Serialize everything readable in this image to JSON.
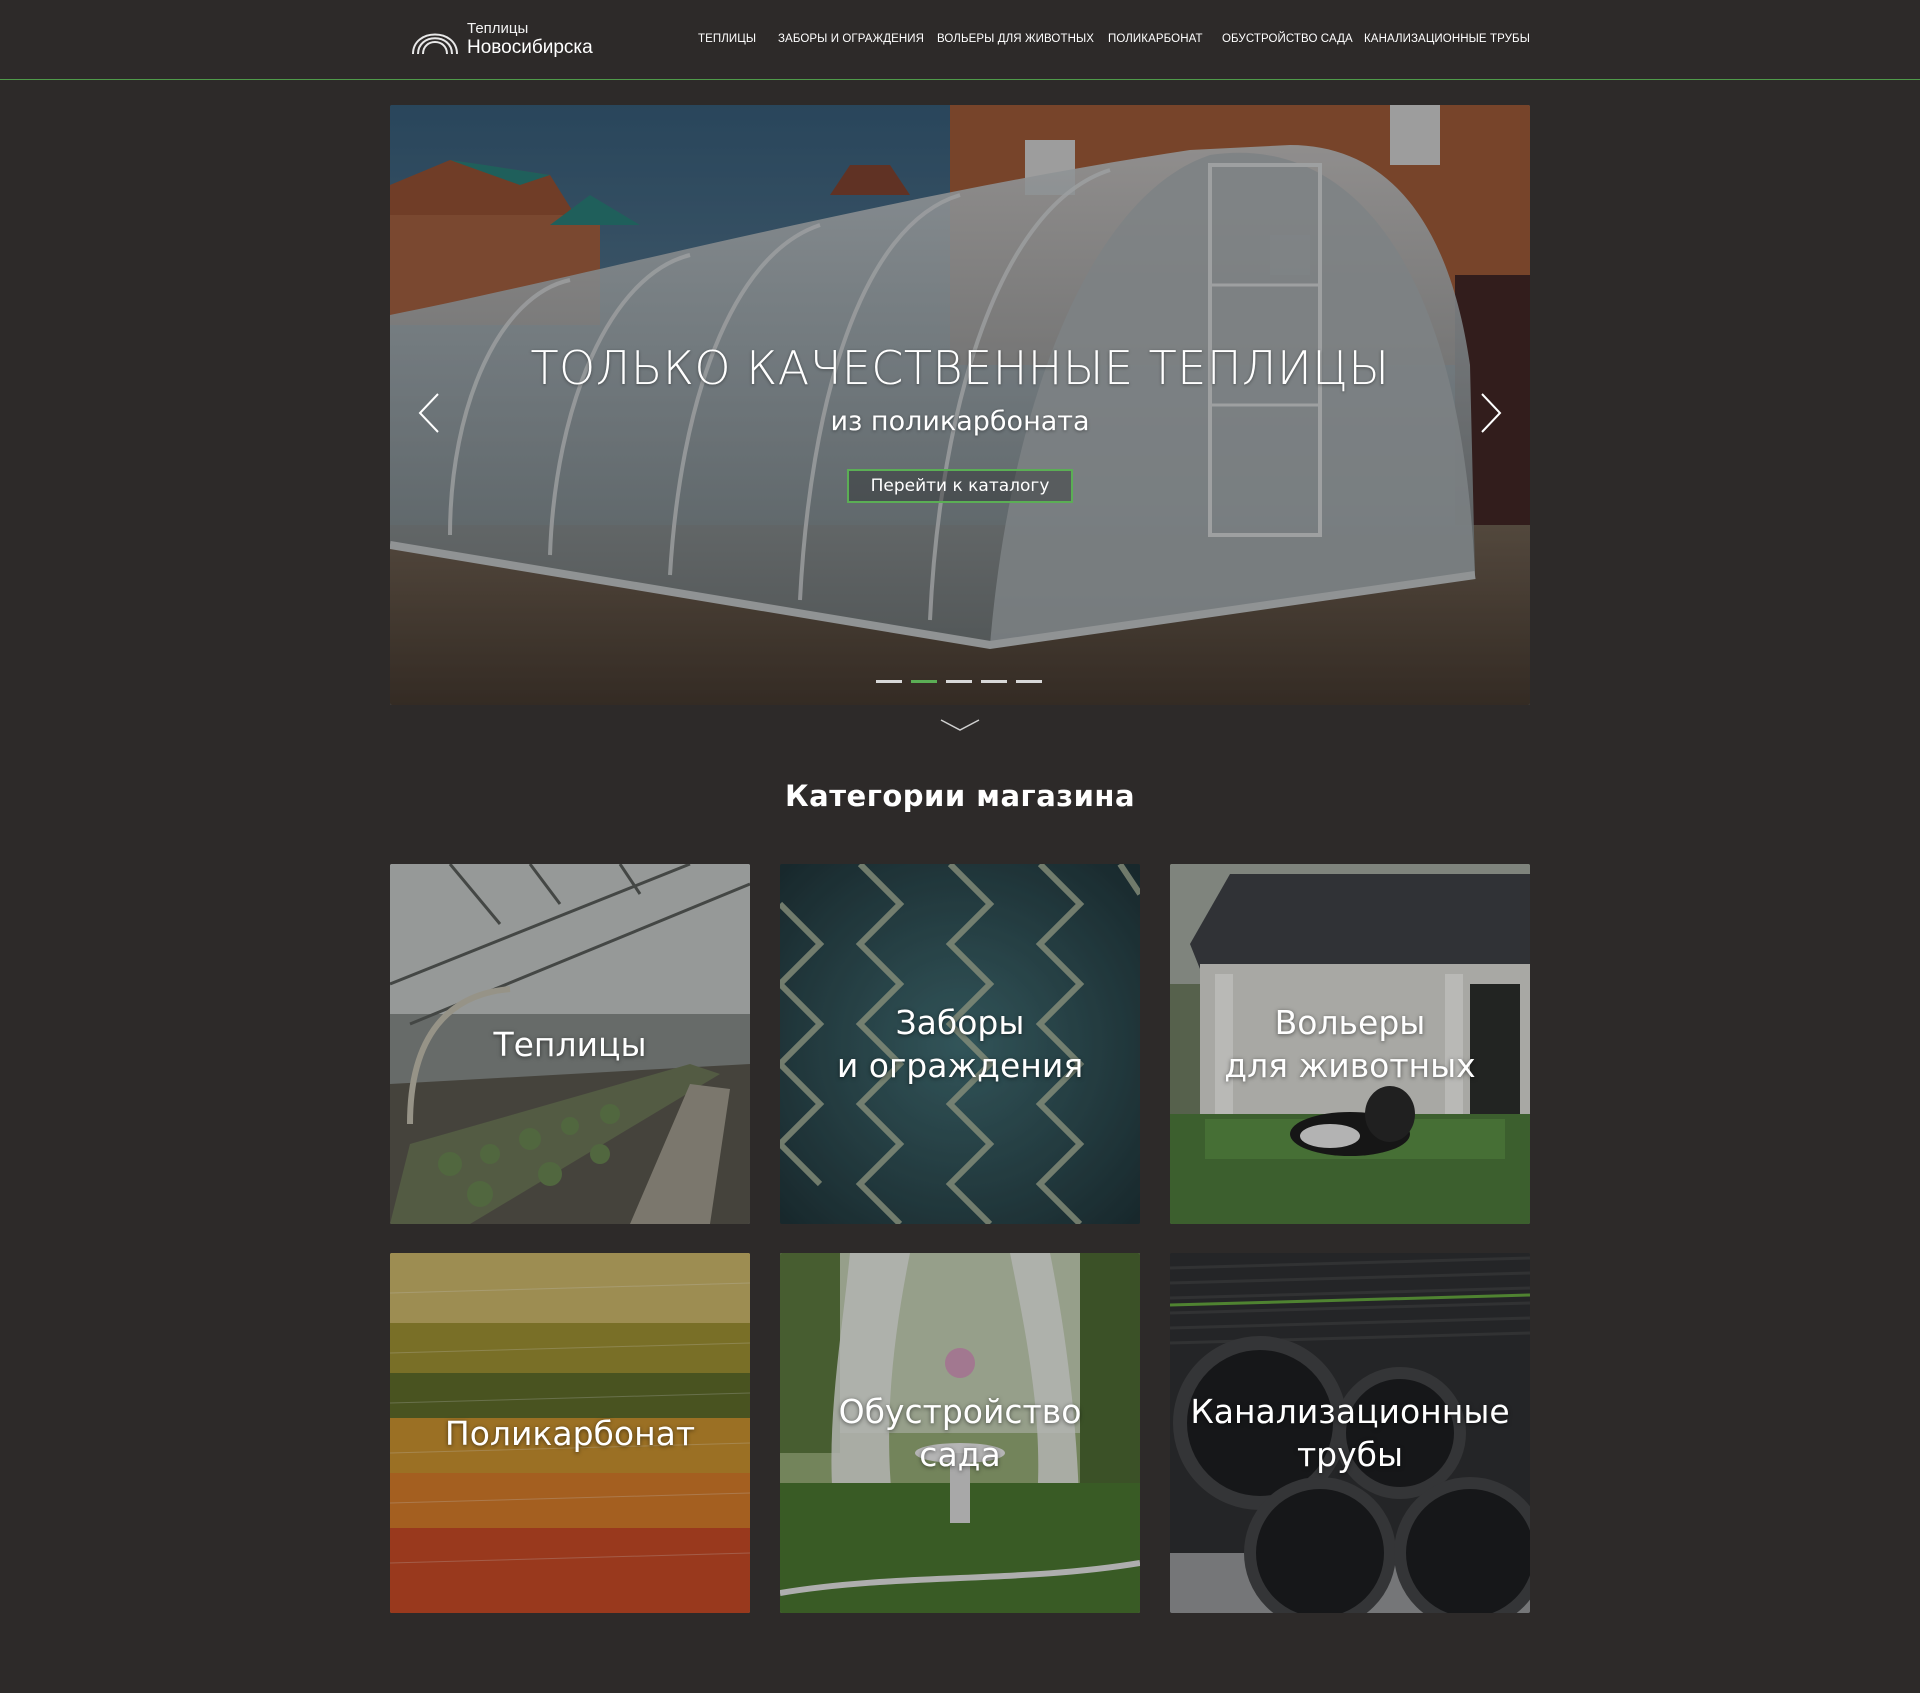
{
  "header": {
    "logo_line1": "Теплицы",
    "logo_line2": "Новосибирска",
    "nav": [
      {
        "label": "ТЕПЛИЦЫ"
      },
      {
        "label": "ЗАБОРЫ И ОГРАЖДЕНИЯ"
      },
      {
        "label": "ВОЛЬЕРЫ ДЛЯ ЖИВОТНЫХ"
      },
      {
        "label": "ПОЛИКАРБОНАТ"
      },
      {
        "label": "ОБУСТРОЙСТВО САДА"
      },
      {
        "label": "КАНАЛИЗАЦИОННЫЕ ТРУБЫ"
      }
    ]
  },
  "hero": {
    "title": "ТОЛЬКО КАЧЕСТВЕННЫЕ ТЕПЛИЦЫ",
    "subtitle": "из поликарбоната",
    "button_label": "Перейти к каталогу",
    "slide_count": 5,
    "active_slide": 2
  },
  "categories": {
    "title": "Категории магазина",
    "items": [
      {
        "label": "Теплицы"
      },
      {
        "label": "Заборы\nи ограждения"
      },
      {
        "label": "Вольеры\nдля животных"
      },
      {
        "label": "Поликарбонат"
      },
      {
        "label": "Обустройство\nсада"
      },
      {
        "label": "Канализационные\nтрубы"
      }
    ]
  },
  "colors": {
    "background": "#2d2a29",
    "accent": "#5bae55",
    "text": "#ffffff"
  }
}
